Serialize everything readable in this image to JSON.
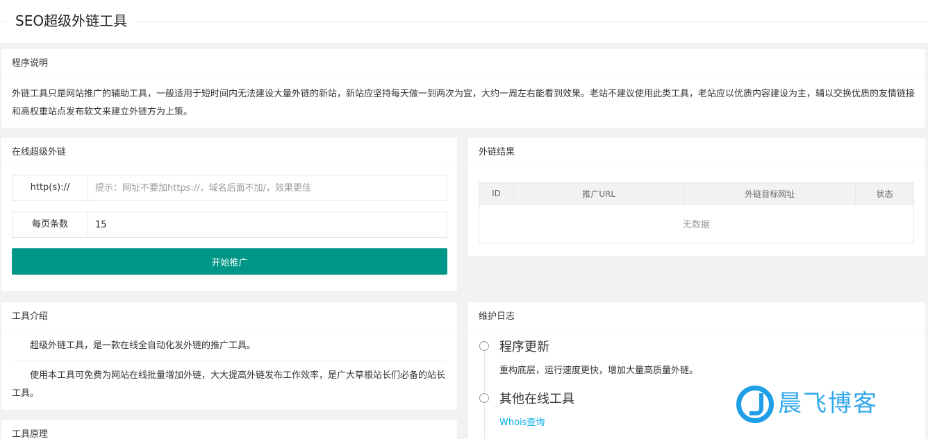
{
  "page": {
    "title": "SEO超级外链工具"
  },
  "program_desc": {
    "header": "程序说明",
    "text": "外链工具只是网站推广的辅助工具，一般适用于短时间内无法建设大量外链的新站，新站应坚持每天做一到两次为宜，大约一周左右能看到效果。老站不建议使用此类工具，老站应以优质内容建设为主，辅以交换优质的友情链接和高权重站点发布软文来建立外链方为上策。"
  },
  "online_form": {
    "header": "在线超级外链",
    "url_label": "http(s)://",
    "url_placeholder": "提示：网址不要加https://，域名后面不加/，效果更佳",
    "url_value": "",
    "per_page_label": "每页条数",
    "per_page_value": "15",
    "submit_label": "开始推广"
  },
  "results": {
    "header": "外链结果",
    "columns": [
      "ID",
      "推广URL",
      "外链目标网址",
      "状态"
    ],
    "empty_text": "无数据"
  },
  "intro": {
    "header": "工具介绍",
    "paragraph1": "超级外链工具，是一款在线全自动化发外链的推广工具。",
    "paragraph2": "使用本工具可免费为网站在线批量增加外链，大大提高外链发布工作效率，是广大草根站长们必备的站长工具。"
  },
  "principle": {
    "header": "工具原理"
  },
  "maintenance": {
    "header": "维护日志",
    "items": [
      {
        "title": "程序更新",
        "text": "重构底层，运行速度更快，增加大量高质量外链。"
      },
      {
        "title": "其他在线工具",
        "link": "Whois查询"
      }
    ]
  },
  "watermark": {
    "name": "晨飞博客"
  },
  "colors": {
    "primary": "#009688",
    "link": "#01aaed",
    "timeline": "#5fb878",
    "watermark": "#1e9fe8"
  }
}
